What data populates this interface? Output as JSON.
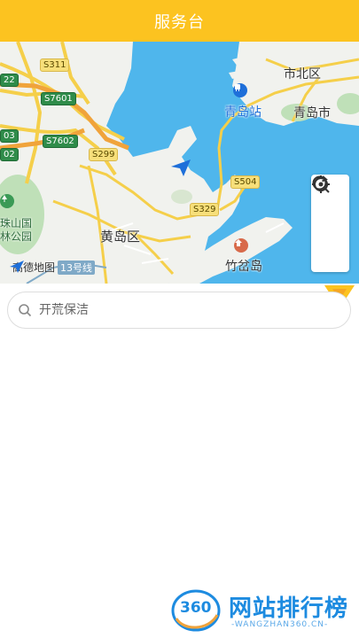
{
  "header": {
    "title": "服务台"
  },
  "map": {
    "labels": {
      "shibei": "市北区",
      "qingdao_station": "青岛站",
      "qingdao_city": "青岛市",
      "huangdao": "黄岛区",
      "zhuchadao": "竹岔岛",
      "park_line1": "珠山国",
      "park_line2": "林公园"
    },
    "roads": {
      "s311": "S311",
      "s7601": "S7601",
      "s7602": "S7602",
      "s299": "S299",
      "s504": "S504",
      "s329": "S329",
      "g22": "22",
      "g03": "03",
      "g02": "02"
    },
    "attribution": {
      "brand": "高德地图",
      "line": "13号线"
    },
    "tools": [
      "search-icon",
      "refresh-icon",
      "locate-icon"
    ],
    "colors": {
      "water": "#4fb6ec",
      "land": "#f1f2ee",
      "road": "#f5cf4a",
      "green": "#bfe0b8"
    }
  },
  "search": {
    "placeholder": "开荒保洁",
    "value": ""
  },
  "watermark": {
    "brand": "网站排行榜",
    "number": "360",
    "domain": "-WANGZHAN360.CN-"
  },
  "theme": {
    "accent": "#fcc320"
  }
}
